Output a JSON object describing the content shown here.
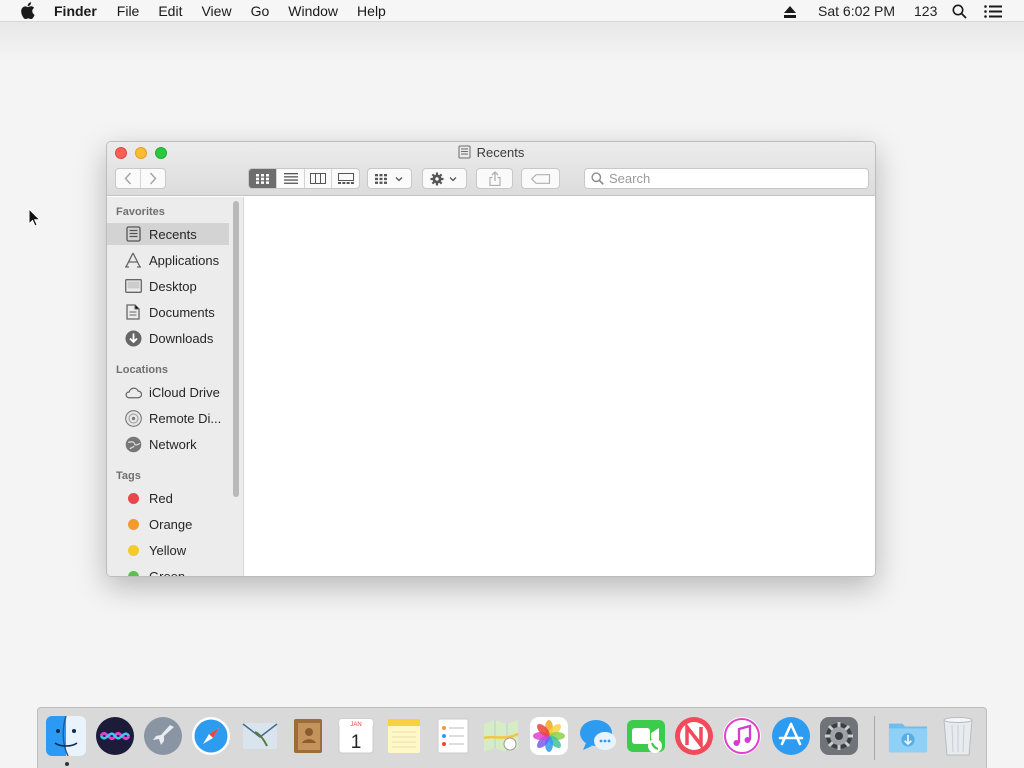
{
  "menubar": {
    "app_name": "Finder",
    "items": [
      "File",
      "Edit",
      "View",
      "Go",
      "Window",
      "Help"
    ],
    "clock": "Sat 6:02 PM",
    "input_source": "123",
    "icons": [
      "apple-icon",
      "eject-icon",
      "spotlight-icon",
      "notification-list-icon"
    ]
  },
  "window": {
    "title": "Recents",
    "search_placeholder": "Search",
    "toolbar": {
      "view_modes": [
        "icon-view",
        "list-view",
        "column-view",
        "gallery-view"
      ],
      "active_view": "icon-view"
    },
    "sidebar": {
      "favorites_heading": "Favorites",
      "favorites": [
        {
          "label": "Recents",
          "icon": "recents-icon",
          "selected": true
        },
        {
          "label": "Applications",
          "icon": "applications-icon"
        },
        {
          "label": "Desktop",
          "icon": "desktop-icon"
        },
        {
          "label": "Documents",
          "icon": "documents-icon"
        },
        {
          "label": "Downloads",
          "icon": "downloads-icon"
        }
      ],
      "locations_heading": "Locations",
      "locations": [
        {
          "label": "iCloud Drive",
          "icon": "icloud-icon"
        },
        {
          "label": "Remote Di...",
          "icon": "remote-disc-icon"
        },
        {
          "label": "Network",
          "icon": "network-icon"
        }
      ],
      "tags_heading": "Tags",
      "tags": [
        {
          "label": "Red",
          "color": "#e8464a"
        },
        {
          "label": "Orange",
          "color": "#f39a2e"
        },
        {
          "label": "Yellow",
          "color": "#f4cb2a"
        },
        {
          "label": "Green",
          "color": "#58c24a"
        }
      ]
    }
  },
  "dock": {
    "apps": [
      "finder-icon",
      "siri-icon",
      "launchpad-icon",
      "safari-icon",
      "mail-icon",
      "contacts-icon",
      "calendar-icon",
      "notes-icon",
      "reminders-icon",
      "maps-icon",
      "photos-icon",
      "messages-icon",
      "facetime-icon",
      "news-icon",
      "itunes-icon",
      "app-store-icon",
      "system-preferences-icon",
      "downloads-folder-icon",
      "trash-icon"
    ],
    "calendar_month": "JAN",
    "calendar_day": "1"
  }
}
